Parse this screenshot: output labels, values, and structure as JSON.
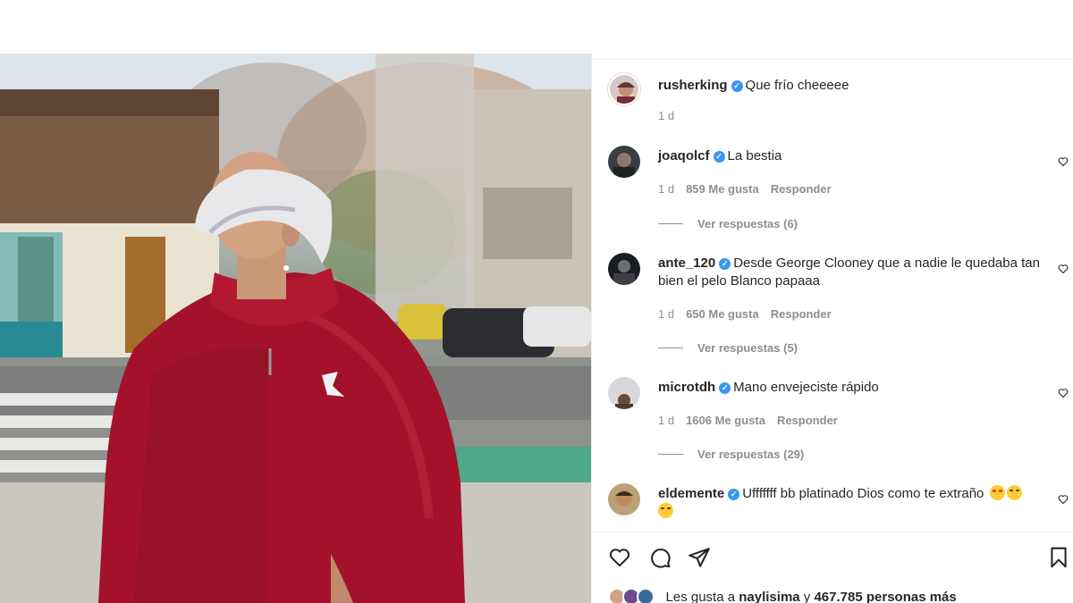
{
  "post": {
    "caption": {
      "username": "rusherking",
      "verified": true,
      "text": "Que frío cheeeee",
      "time": "1 d"
    },
    "comments": [
      {
        "username": "joaqolcf",
        "verified": true,
        "text": "La bestia",
        "time": "1 d",
        "likes": "859 Me gusta",
        "reply_label": "Responder",
        "view_replies": "Ver respuestas (6)"
      },
      {
        "username": "ante_120",
        "verified": true,
        "text": "Desde George Clooney que a nadie le quedaba tan bien el pelo Blanco papaaa",
        "time": "1 d",
        "likes": "650 Me gusta",
        "reply_label": "Responder",
        "view_replies": "Ver respuestas (5)"
      },
      {
        "username": "microtdh",
        "verified": true,
        "text": "Mano envejeciste rápido",
        "time": "1 d",
        "likes": "1606 Me gusta",
        "reply_label": "Responder",
        "view_replies": "Ver respuestas (29)"
      },
      {
        "username": "eldemente",
        "verified": true,
        "text": "Ufffffff bb platinado Dios como te extraño"
      }
    ],
    "likes_summary": {
      "prefix": "Les gusta a",
      "user": "naylisima",
      "middle": "y",
      "count": "467.785 personas más"
    }
  },
  "icons": {
    "like": "heart-icon",
    "comment": "comment-icon",
    "share": "paper-plane-icon",
    "save": "bookmark-icon"
  },
  "colors": {
    "verified": "#3897f0",
    "muted": "#8e8e8e",
    "jacket": "#a3122a"
  }
}
